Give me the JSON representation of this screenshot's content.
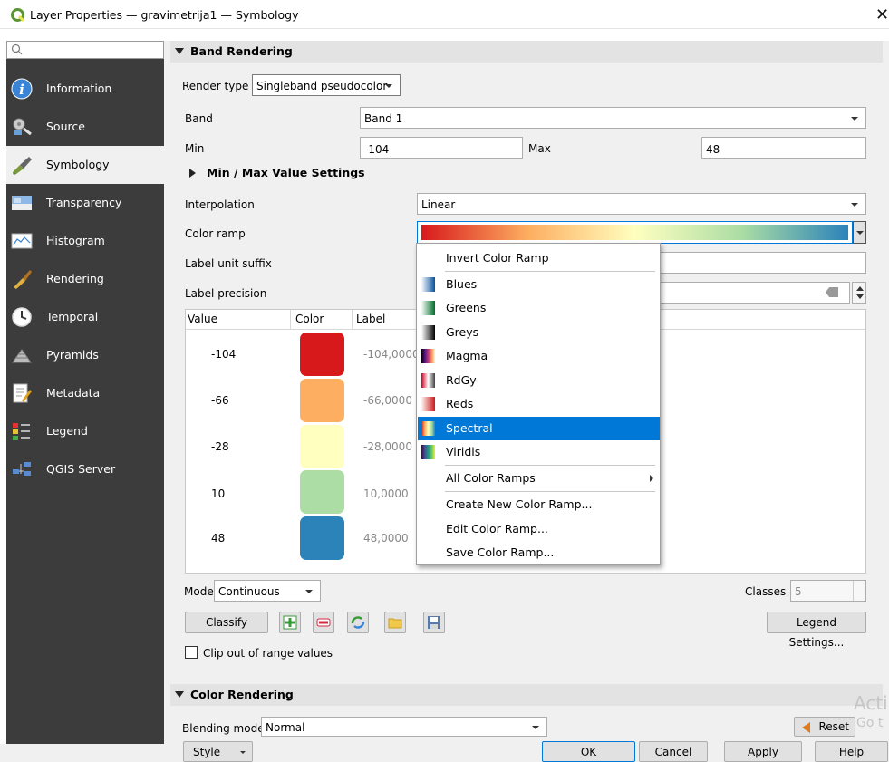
{
  "window": {
    "title": "Layer Properties — gravimetrija1 — Symbology",
    "close": "✕"
  },
  "sidebar": {
    "items": [
      {
        "label": "Information",
        "icon": "info-icon"
      },
      {
        "label": "Source",
        "icon": "source-icon"
      },
      {
        "label": "Symbology",
        "icon": "symbology-icon",
        "selected": true
      },
      {
        "label": "Transparency",
        "icon": "transparency-icon"
      },
      {
        "label": "Histogram",
        "icon": "histogram-icon"
      },
      {
        "label": "Rendering",
        "icon": "rendering-icon"
      },
      {
        "label": "Temporal",
        "icon": "clock-icon"
      },
      {
        "label": "Pyramids",
        "icon": "pyramids-icon"
      },
      {
        "label": "Metadata",
        "icon": "metadata-icon"
      },
      {
        "label": "Legend",
        "icon": "legend-icon"
      },
      {
        "label": "QGIS Server",
        "icon": "server-icon"
      }
    ]
  },
  "band_rendering": {
    "header": "Band Rendering",
    "render_type_label": "Render type",
    "render_type_value": "Singleband pseudocolor",
    "band_label": "Band",
    "band_value": "Band 1",
    "min_label": "Min",
    "min_value": "-104",
    "max_label": "Max",
    "max_value": "48",
    "minmax_settings": "Min / Max Value Settings",
    "interpolation_label": "Interpolation",
    "interpolation_value": "Linear",
    "color_ramp_label": "Color ramp",
    "label_unit_suffix_label": "Label unit suffix",
    "label_precision_label": "Label precision",
    "table": {
      "headers": [
        "Value",
        "Color",
        "Label"
      ],
      "rows": [
        {
          "value": "-104",
          "color": "#d7191c",
          "label": "-104,0000"
        },
        {
          "value": "-66",
          "color": "#fdae61",
          "label": "-66,0000"
        },
        {
          "value": "-28",
          "color": "#ffffbf",
          "label": "-28,0000"
        },
        {
          "value": "10",
          "color": "#abdda4",
          "label": "10,0000"
        },
        {
          "value": "48",
          "color": "#2b83ba",
          "label": "48,0000"
        }
      ]
    },
    "mode_label": "Mode",
    "mode_value": "Continuous",
    "classes_label": "Classes",
    "classes_value": "5",
    "classify_button": "Classify",
    "legend_settings_button": "Legend Settings...",
    "clip_label": "Clip out of range values"
  },
  "ramp_menu": {
    "invert": "Invert Color Ramp",
    "ramps": [
      {
        "label": "Blues",
        "icon": "blues-ramp-icon"
      },
      {
        "label": "Greens",
        "icon": "greens-ramp-icon"
      },
      {
        "label": "Greys",
        "icon": "greys-ramp-icon"
      },
      {
        "label": "Magma",
        "icon": "magma-ramp-icon"
      },
      {
        "label": "RdGy",
        "icon": "rdgy-ramp-icon"
      },
      {
        "label": "Reds",
        "icon": "reds-ramp-icon"
      },
      {
        "label": "Spectral",
        "icon": "spectral-ramp-icon",
        "highlighted": true
      },
      {
        "label": "Viridis",
        "icon": "viridis-ramp-icon"
      }
    ],
    "all_ramps": "All Color Ramps",
    "create": "Create New Color Ramp...",
    "edit": "Edit Color Ramp...",
    "save": "Save Color Ramp..."
  },
  "color_rendering": {
    "header": "Color Rendering",
    "blending_label": "Blending mode",
    "blending_value": "Normal",
    "reset_button": "Reset"
  },
  "footer": {
    "style_button": "Style",
    "ok_button": "OK",
    "cancel_button": "Cancel",
    "apply_button": "Apply",
    "help_button": "Help"
  },
  "watermark": {
    "line1": "Acti",
    "line2": "Go t"
  },
  "colors": {
    "sidebar_bg": "#3c3c3c",
    "highlight": "#0078d7",
    "panel_bg": "#f0f0f0"
  }
}
